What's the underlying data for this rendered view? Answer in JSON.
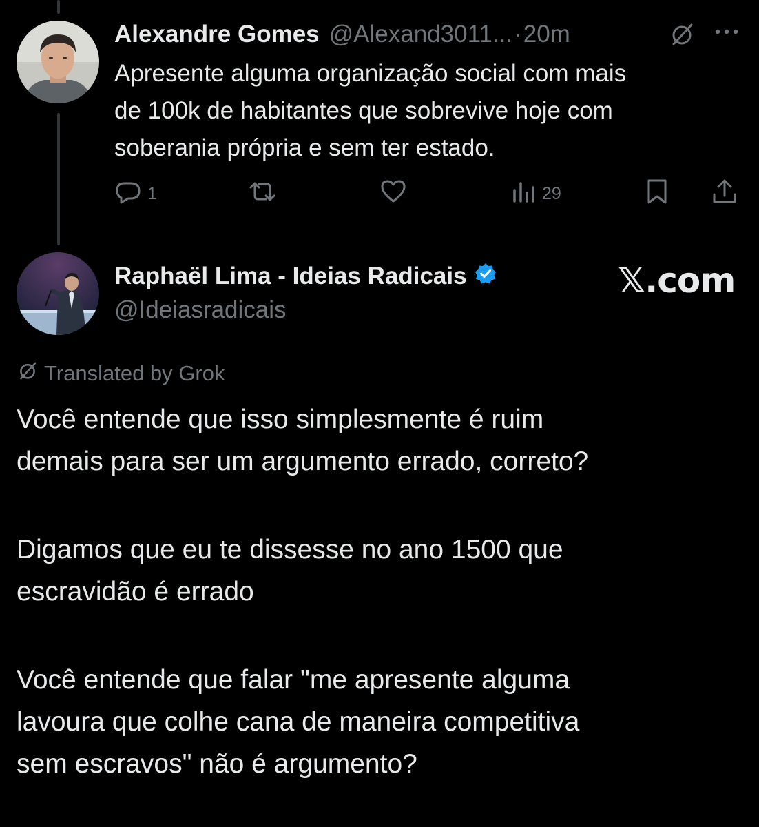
{
  "colors": {
    "background": "#000000",
    "text_primary": "#e7e9ea",
    "text_secondary": "#71767b",
    "thread_line": "#333639",
    "verified": "#1d9bf0"
  },
  "tweet1": {
    "author_name": "Alexandre Gomes",
    "handle": "@Alexand3011...",
    "separator": "·",
    "time": "20m",
    "text_lines": [
      "Apresente alguma organização social com mais",
      "de 100k de habitantes que sobrevive hoje com",
      "soberania própria e sem ter estado."
    ],
    "actions": {
      "reply": {
        "icon": "reply-icon",
        "count": "1"
      },
      "retweet": {
        "icon": "retweet-icon"
      },
      "like": {
        "icon": "heart-icon"
      },
      "views": {
        "icon": "views-icon",
        "count": "29"
      },
      "bookmark": {
        "icon": "bookmark-icon"
      },
      "share": {
        "icon": "share-icon"
      }
    },
    "header_icons": [
      "grok-translate-icon",
      "more-icon"
    ]
  },
  "tweet2": {
    "author_name": "Raphaël Lima - Ideias Radicais",
    "handle": "@Ideiasradicais",
    "verified_icon": "verified-badge-icon",
    "translated_label": "Translated by Grok",
    "paragraphs": [
      [
        "Você entende que isso simplesmente é ruim",
        "demais para ser um argumento errado, correto?"
      ],
      [
        "Digamos que eu te dissesse no ano 1500 que",
        "escravidão é errado"
      ],
      [
        "Você entende que falar \"me apresente alguma",
        "lavoura que colhe cana de maneira competitiva",
        "sem escravos\" não é argumento?"
      ]
    ]
  },
  "watermark": "𝕏.com"
}
